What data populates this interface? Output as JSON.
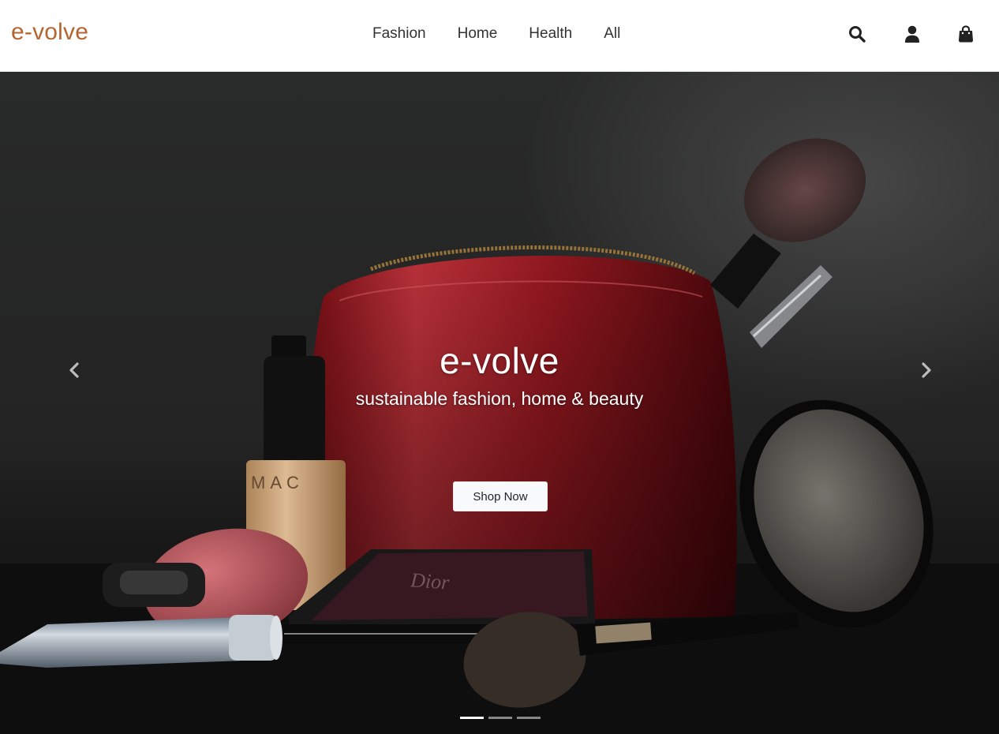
{
  "navbar": {
    "brand": "e-volve",
    "brand_color": "#b5652f",
    "links": [
      {
        "label": "Fashion"
      },
      {
        "label": "Home"
      },
      {
        "label": "Health"
      },
      {
        "label": "All"
      }
    ],
    "icons": [
      "search-icon",
      "user-icon",
      "shopping-bag-icon"
    ]
  },
  "hero": {
    "title": "e-volve",
    "subtitle": "sustainable fashion, home & beauty",
    "cta_label": "Shop Now",
    "prev_icon": "chevron-left-icon",
    "next_icon": "chevron-right-icon",
    "slides_total": 3,
    "active_slide": 1,
    "product_labels": [
      "MAC",
      "Dior"
    ]
  }
}
